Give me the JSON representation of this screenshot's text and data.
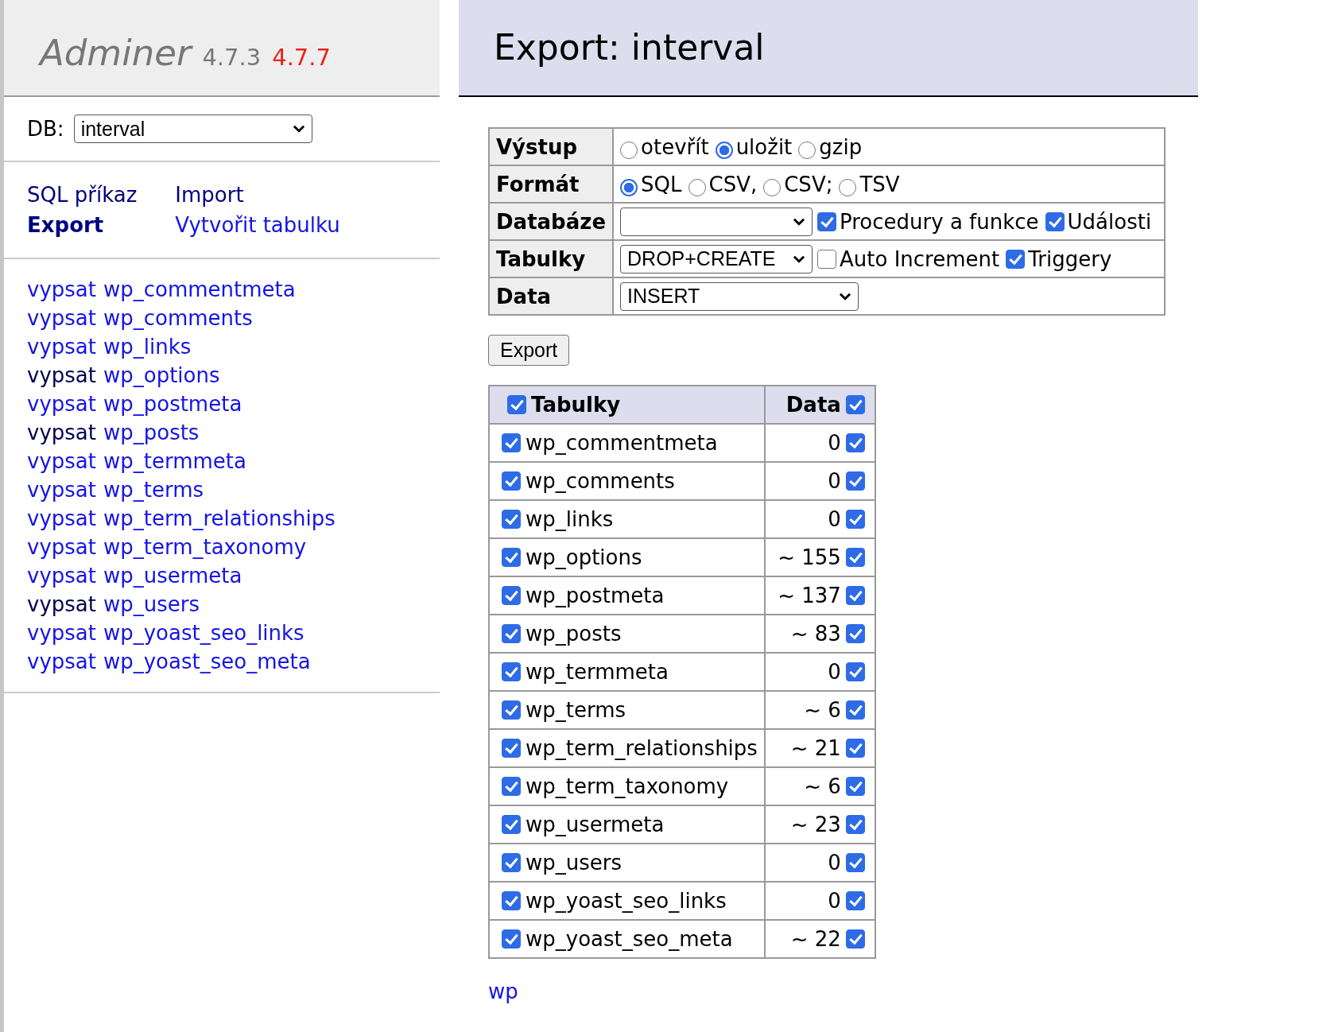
{
  "sidebar": {
    "logo": "Adminer",
    "version": "4.7.3",
    "new_version": "4.7.7",
    "db_label": "DB:",
    "db_value": "interval",
    "links": [
      {
        "label": "SQL příkaz",
        "selected": false,
        "visited": true
      },
      {
        "label": "Import",
        "selected": false,
        "visited": true
      },
      {
        "label": "Export",
        "selected": true,
        "visited": true
      },
      {
        "label": "Vytvořit tabulku",
        "selected": false,
        "visited": false
      }
    ],
    "tables": [
      {
        "select": "vypsat",
        "name": "wp_commentmeta",
        "visited": false
      },
      {
        "select": "vypsat",
        "name": "wp_comments",
        "visited": false
      },
      {
        "select": "vypsat",
        "name": "wp_links",
        "visited": false
      },
      {
        "select": "vypsat",
        "name": "wp_options",
        "visited": true
      },
      {
        "select": "vypsat",
        "name": "wp_postmeta",
        "visited": false
      },
      {
        "select": "vypsat",
        "name": "wp_posts",
        "visited": true
      },
      {
        "select": "vypsat",
        "name": "wp_termmeta",
        "visited": false
      },
      {
        "select": "vypsat",
        "name": "wp_terms",
        "visited": false
      },
      {
        "select": "vypsat",
        "name": "wp_term_relationships",
        "visited": false
      },
      {
        "select": "vypsat",
        "name": "wp_term_taxonomy",
        "visited": false
      },
      {
        "select": "vypsat",
        "name": "wp_usermeta",
        "visited": false
      },
      {
        "select": "vypsat",
        "name": "wp_users",
        "visited": true
      },
      {
        "select": "vypsat",
        "name": "wp_yoast_seo_links",
        "visited": false
      },
      {
        "select": "vypsat",
        "name": "wp_yoast_seo_meta",
        "visited": false
      }
    ]
  },
  "main": {
    "title": "Export: interval",
    "options": [
      {
        "kind": "radio",
        "label": "Výstup",
        "choices": [
          {
            "label": "otevřít",
            "selected": false
          },
          {
            "label": "uložit",
            "selected": true
          },
          {
            "label": "gzip",
            "selected": false
          }
        ]
      },
      {
        "kind": "radio",
        "label": "Formát",
        "choices": [
          {
            "label": "SQL",
            "selected": true
          },
          {
            "label": "CSV,",
            "selected": false
          },
          {
            "label": "CSV;",
            "selected": false
          },
          {
            "label": "TSV",
            "selected": false
          }
        ]
      },
      {
        "kind": "select",
        "label": "Databáze",
        "checks": [
          {
            "label": "Procedury a funkce",
            "checked": true
          },
          {
            "label": "Události",
            "checked": true
          }
        ]
      },
      {
        "kind": "select",
        "label": "Tabulky",
        "value": "DROP+CREATE",
        "checks": [
          {
            "label": "Auto Increment",
            "checked": false
          },
          {
            "label": "Triggery",
            "checked": true
          }
        ]
      },
      {
        "kind": "select",
        "label": "Data",
        "value": "INSERT"
      }
    ],
    "export_button": "Export",
    "tables_table": {
      "header": {
        "tables_label": "Tabulky",
        "tables_checked": true,
        "data_label": "Data",
        "data_checked": true
      },
      "rows": [
        {
          "name": "wp_commentmeta",
          "checked": true,
          "rows": "0",
          "data_checked": true
        },
        {
          "name": "wp_comments",
          "checked": true,
          "rows": "0",
          "data_checked": true
        },
        {
          "name": "wp_links",
          "checked": true,
          "rows": "0",
          "data_checked": true
        },
        {
          "name": "wp_options",
          "checked": true,
          "rows": "~ 155",
          "data_checked": true
        },
        {
          "name": "wp_postmeta",
          "checked": true,
          "rows": "~ 137",
          "data_checked": true
        },
        {
          "name": "wp_posts",
          "checked": true,
          "rows": "~ 83",
          "data_checked": true
        },
        {
          "name": "wp_termmeta",
          "checked": true,
          "rows": "0",
          "data_checked": true
        },
        {
          "name": "wp_terms",
          "checked": true,
          "rows": "~ 6",
          "data_checked": true
        },
        {
          "name": "wp_term_relationships",
          "checked": true,
          "rows": "~ 21",
          "data_checked": true
        },
        {
          "name": "wp_term_taxonomy",
          "checked": true,
          "rows": "~ 6",
          "data_checked": true
        },
        {
          "name": "wp_usermeta",
          "checked": true,
          "rows": "~ 23",
          "data_checked": true
        },
        {
          "name": "wp_users",
          "checked": true,
          "rows": "0",
          "data_checked": true
        },
        {
          "name": "wp_yoast_seo_links",
          "checked": true,
          "rows": "0",
          "data_checked": true
        },
        {
          "name": "wp_yoast_seo_meta",
          "checked": true,
          "rows": "~ 22",
          "data_checked": true
        }
      ]
    },
    "footer_link": "wp"
  }
}
